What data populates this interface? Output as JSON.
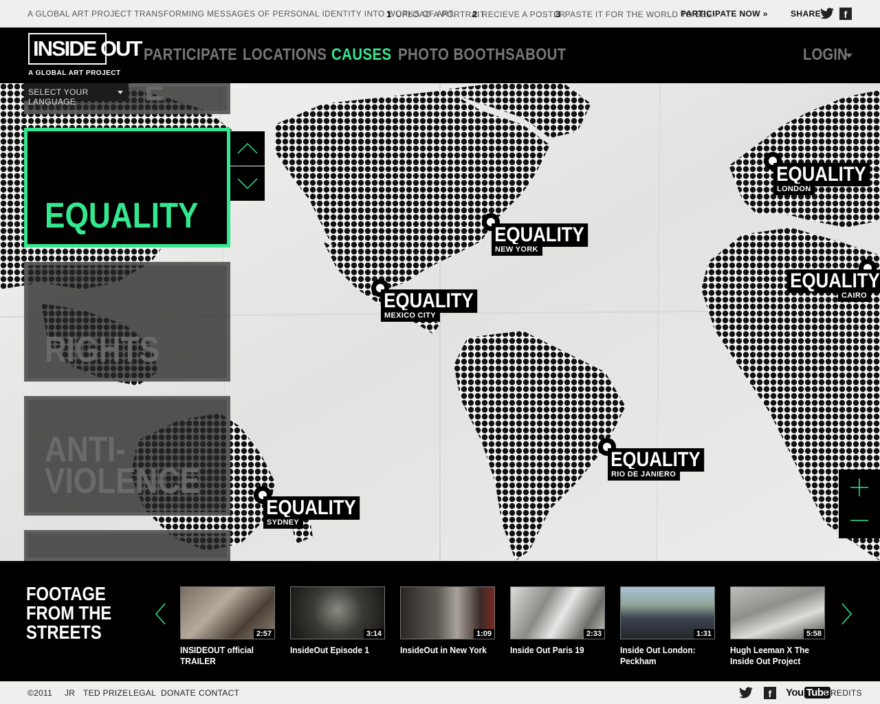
{
  "topbar": {
    "tagline": "A global art project transforming messages of personal identity into works of art.",
    "steps": [
      {
        "num": "1",
        "label": "Upload a portrait"
      },
      {
        "num": "2",
        "label": "Recieve a poster"
      },
      {
        "num": "3",
        "label": "Paste it for the world to see"
      }
    ],
    "participate_now": "Participate Now »",
    "share_label": "Share",
    "facebook_glyph": "f"
  },
  "header": {
    "logo": "INSIDE OUT",
    "logo_sub": "A Global Art Project",
    "nav": [
      "Participate",
      "Locations",
      "Causes",
      "Photo Booths",
      "About"
    ],
    "active_nav": "Causes",
    "login": "Login"
  },
  "language": {
    "label": "Select your language"
  },
  "causes": {
    "partial_top": "E",
    "active": "Equality",
    "items": [
      "Rights",
      "Anti-",
      "Violence"
    ]
  },
  "markers": [
    {
      "title": "Equality",
      "city": "London"
    },
    {
      "title": "Equality",
      "city": "New York"
    },
    {
      "title": "Equality",
      "city": "Cairo"
    },
    {
      "title": "Equality",
      "city": "Mexico City"
    },
    {
      "title": "Equality",
      "city": "Rio de Janiero"
    },
    {
      "title": "Equality",
      "city": "Sydney"
    }
  ],
  "footage": {
    "title_lines": [
      "Footage",
      "from the",
      "streets"
    ],
    "videos": [
      {
        "title": "INSIDEOUT official TRAILER",
        "duration": "2:57"
      },
      {
        "title": "InsideOut Episode 1",
        "duration": "3:14"
      },
      {
        "title": "InsideOut in New York",
        "duration": "1:09"
      },
      {
        "title": "Inside Out Paris 19",
        "duration": "2:33"
      },
      {
        "title": "Inside Out London: Peckham",
        "duration": "1:31"
      },
      {
        "title": "Hugh Leeman X The Inside Out Project",
        "duration": "5:58"
      }
    ]
  },
  "footer": {
    "copyright": "©2011",
    "links": [
      "JR",
      "TED Prize",
      "Legal",
      "Donate",
      "Contact"
    ],
    "youtube_you": "You",
    "youtube_tube": "Tube",
    "credits": "Credits"
  },
  "colors": {
    "accent": "#34e890",
    "header_bg": "#000000",
    "map_bg": "#ececea"
  },
  "icons": [
    "twitter-icon",
    "facebook-icon",
    "youtube-icon",
    "chevron-up-icon",
    "chevron-down-icon",
    "plus-icon",
    "minus-icon",
    "arrow-left-icon",
    "arrow-right-icon",
    "caret-down-icon"
  ]
}
